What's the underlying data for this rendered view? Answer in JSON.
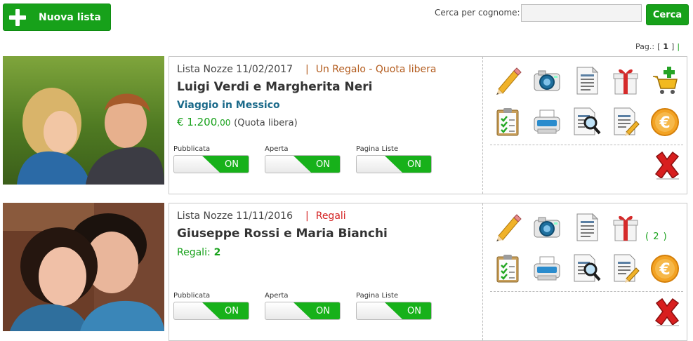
{
  "toolbar": {
    "new_list_label": "Nuova lista",
    "search_label": "Cerca per cognome:",
    "search_value": "",
    "search_button": "Cerca"
  },
  "pager": {
    "label": "Pag.:",
    "open_bracket": "[",
    "current": "1",
    "close_bracket": "]",
    "separator": "|"
  },
  "lists": [
    {
      "title": "Lista Nozze 11/02/2017",
      "separator": "|",
      "type": "Un Regalo - Quota libera",
      "names": "Luigi Verdi e Margherita Neri",
      "destination": "Viaggio in Messico",
      "price_main": "€ 1.200",
      "price_decimal": ",00",
      "price_note": "(Quota libera)",
      "toggles": [
        {
          "label": "Pubblicata",
          "state": "ON"
        },
        {
          "label": "Aperta",
          "state": "ON"
        },
        {
          "label": "Pagina Liste",
          "state": "ON"
        }
      ]
    },
    {
      "title": "Lista Nozze 11/11/2016",
      "separator": "|",
      "type": "Regali",
      "names": "Giuseppe Rossi e Maria Bianchi",
      "gifts_label": "Regali:",
      "gifts_count": "2",
      "gift_badge": "( 2 )",
      "toggles": [
        {
          "label": "Pubblicata",
          "state": "ON"
        },
        {
          "label": "Aperta",
          "state": "ON"
        },
        {
          "label": "Pagina Liste",
          "state": "ON"
        }
      ]
    }
  ],
  "icons": {
    "row1": [
      "edit-pencil-icon",
      "camera-icon",
      "document-icon",
      "gift-icon",
      "add-to-cart-icon"
    ],
    "row2": [
      "clipboard-checklist-icon",
      "printer-icon",
      "document-search-icon",
      "document-edit-icon",
      "euro-coin-icon"
    ],
    "delete": "delete-x-icon"
  },
  "colors": {
    "accent_green": "#17a11a",
    "list_type_brown": "#b35c1e",
    "list_type_red": "#d32020",
    "destination_blue": "#1b6a8a"
  }
}
